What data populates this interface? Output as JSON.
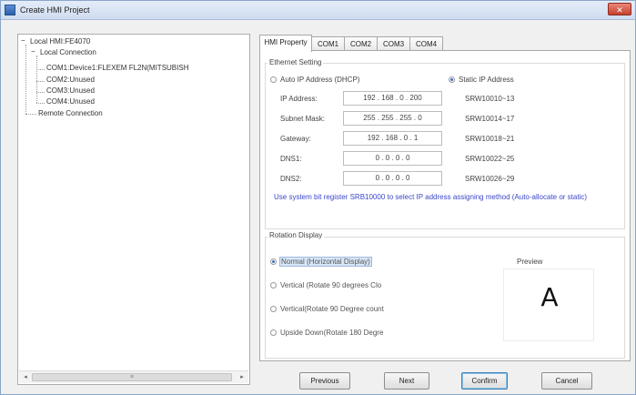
{
  "window": {
    "title": "Create HMI Project",
    "close_glyph": "✕"
  },
  "tree": {
    "root": {
      "expander": "−",
      "label": "Local HMI:FE4070"
    },
    "local": {
      "expander": "−",
      "label": "Local Connection"
    },
    "com1": "COM1:Device1:FLEXEM FL2N(MITSUBISH",
    "com2": "COM2:Unused",
    "com3": "COM3:Unused",
    "com4": "COM4:Unused",
    "remote": "Remote Connection",
    "scroll": {
      "left": "◂",
      "right": "▸",
      "thumb": "≡"
    }
  },
  "tabs": [
    {
      "label": "HMI Property",
      "active": true
    },
    {
      "label": "COM1",
      "active": false
    },
    {
      "label": "COM2",
      "active": false
    },
    {
      "label": "COM3",
      "active": false
    },
    {
      "label": "COM4",
      "active": false
    }
  ],
  "ethernet": {
    "title": "Ethernet Setting",
    "auto_ip": {
      "label": "Auto IP Address (DHCP)",
      "selected": false
    },
    "static_ip": {
      "label": "Static IP Address",
      "selected": true
    },
    "fields": [
      {
        "label": "IP Address:",
        "value": "192 . 168 .  0  . 200",
        "register": "SRW10010~13"
      },
      {
        "label": "Subnet Mask:",
        "value": "255 . 255 . 255 .  0",
        "register": "SRW10014~17"
      },
      {
        "label": "Gateway:",
        "value": "192 . 168 .  0  .  1",
        "register": "SRW10018~21"
      },
      {
        "label": "DNS1:",
        "value": "0  .  0  .  0  .  0",
        "register": "SRW10022~25"
      },
      {
        "label": "DNS2:",
        "value": "0  .  0  .  0  .  0",
        "register": "SRW10026~29"
      }
    ],
    "note": "Use system bit register SRB10000 to select IP address assigning method (Auto-allocate or static)"
  },
  "rotation": {
    "title": "Rotation Display",
    "options": [
      {
        "label": "Normal (Horizontal Display)",
        "selected": true
      },
      {
        "label": "Vertical (Rotate 90 degrees Clo",
        "selected": false
      },
      {
        "label": "Vertical(Rotate 90 Degree count",
        "selected": false
      },
      {
        "label": "Upside Down(Rotate 180 Degre",
        "selected": false
      }
    ],
    "preview_label": "Preview",
    "preview_glyph": "A"
  },
  "buttons": {
    "previous": "Previous",
    "next": "Next",
    "confirm": "Confirm",
    "cancel": "Cancel"
  },
  "colors": {
    "accent": "#3a6cc2",
    "note_text": "#3a47c9"
  },
  "icons": {
    "title_icon": "hmi-app-icon",
    "close_icon": "close-icon"
  }
}
